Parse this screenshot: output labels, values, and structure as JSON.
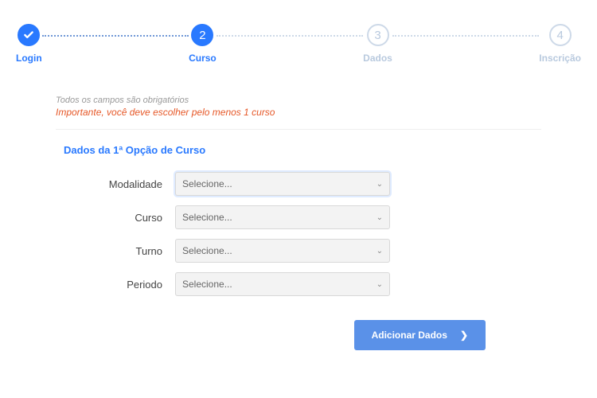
{
  "stepper": {
    "steps": [
      {
        "label": "Login",
        "status": "done"
      },
      {
        "label": "Curso",
        "status": "current",
        "num": "2"
      },
      {
        "label": "Dados",
        "status": "upcoming",
        "num": "3"
      },
      {
        "label": "Inscrição",
        "status": "upcoming",
        "num": "4"
      }
    ]
  },
  "notes": {
    "required": "Todos os campos são obrigatórios",
    "important": "Importante, você deve escolher pelo menos 1 curso"
  },
  "section": {
    "title": "Dados da 1ª Opção de Curso"
  },
  "fields": {
    "modalidade": {
      "label": "Modalidade",
      "placeholder": "Selecione..."
    },
    "curso": {
      "label": "Curso",
      "placeholder": "Selecione..."
    },
    "turno": {
      "label": "Turno",
      "placeholder": "Selecione..."
    },
    "periodo": {
      "label": "Periodo",
      "placeholder": "Selecione..."
    }
  },
  "actions": {
    "next": "Adicionar Dados"
  }
}
